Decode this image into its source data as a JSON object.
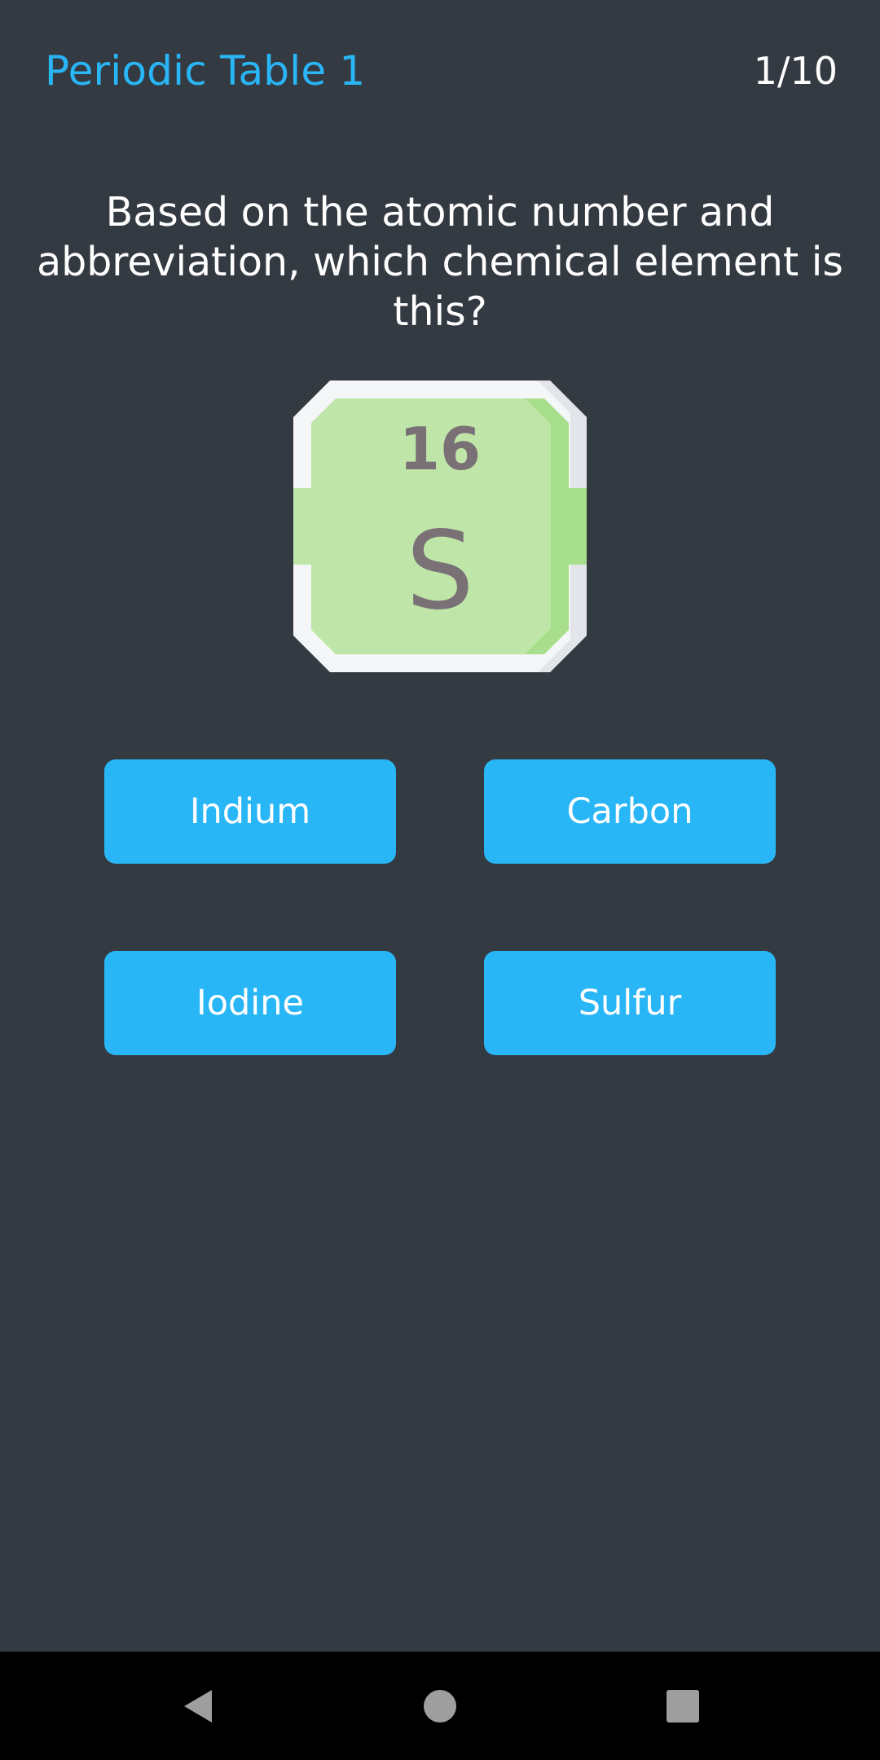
{
  "header": {
    "title": "Periodic Table 1",
    "progress": "1/10"
  },
  "question": {
    "text": "Based on the atomic number and abbreviation, which chemical element is this?"
  },
  "element_tile": {
    "atomic_number": "16",
    "symbol": "S",
    "colors": {
      "fill": "#bfe6a8",
      "fill_dark": "#a8df8c",
      "frame": "#f5f6f8",
      "frame_shadow": "#e3e5ea",
      "text": "#7a7176"
    }
  },
  "answers": [
    {
      "label": "Indium"
    },
    {
      "label": "Carbon"
    },
    {
      "label": "Iodine"
    },
    {
      "label": "Sulfur"
    }
  ],
  "colors": {
    "background": "#343a42",
    "accent": "#29b6f6",
    "text": "#ffffff",
    "nav_bar": "#000000",
    "nav_icons": "#9e9e9e"
  },
  "nav": {
    "back_icon": "back-triangle-icon",
    "home_icon": "home-circle-icon",
    "recents_icon": "recents-square-icon"
  }
}
